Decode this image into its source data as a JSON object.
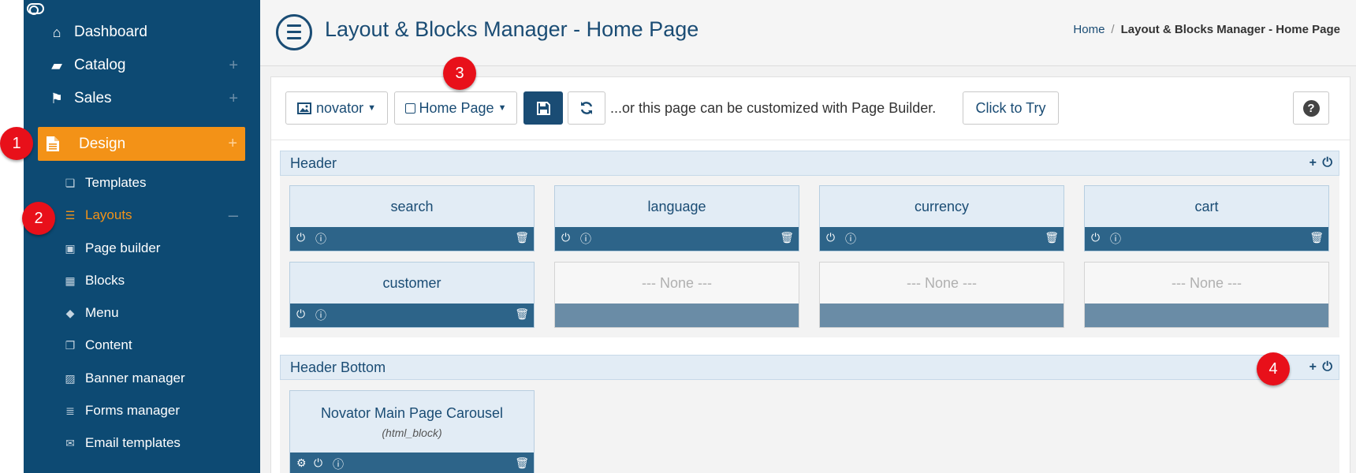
{
  "sidebar": {
    "top_items": [
      {
        "label": "Dashboard",
        "icon": "home-icon"
      },
      {
        "label": "Catalog",
        "icon": "folder-icon"
      },
      {
        "label": "Sales",
        "icon": "flag-icon"
      }
    ],
    "active_item": {
      "label": "Design",
      "icon": "file-icon"
    },
    "sub_items": [
      {
        "label": "Templates",
        "icon": "templates-icon"
      },
      {
        "label": "Layouts",
        "icon": "list-icon"
      },
      {
        "label": "Page builder",
        "icon": "page-builder-icon"
      },
      {
        "label": "Blocks",
        "icon": "blocks-icon"
      },
      {
        "label": "Menu",
        "icon": "tag-icon"
      },
      {
        "label": "Content",
        "icon": "content-icon"
      },
      {
        "label": "Banner manager",
        "icon": "image-icon"
      },
      {
        "label": "Forms manager",
        "icon": "forms-icon"
      },
      {
        "label": "Email templates",
        "icon": "envelope-icon"
      }
    ]
  },
  "header": {
    "title": "Layout & Blocks Manager - Home Page",
    "breadcrumb": {
      "home": "Home",
      "separator": "/",
      "current": "Layout & Blocks Manager - Home Page"
    }
  },
  "toolbar": {
    "template_label": "novator",
    "page_label": "Home Page",
    "builder_text": "...or this page can be customized with Page Builder.",
    "try_label": "Click to Try",
    "help_label": "?"
  },
  "sections": {
    "header": {
      "title": "Header",
      "blocks": [
        "search",
        "language",
        "currency",
        "cart",
        "customer",
        "--- None ---",
        "--- None ---",
        "--- None ---"
      ]
    },
    "header_bottom": {
      "title": "Header Bottom",
      "blocks": [
        {
          "name": "Novator Main Page Carousel",
          "type": "(html_block)"
        }
      ]
    }
  },
  "markers": [
    "1",
    "2",
    "3",
    "4"
  ],
  "colors": {
    "sidebar": "#0d4a73",
    "accent": "#f39217",
    "primary": "#1a4c74",
    "marker": "#e8101a"
  }
}
